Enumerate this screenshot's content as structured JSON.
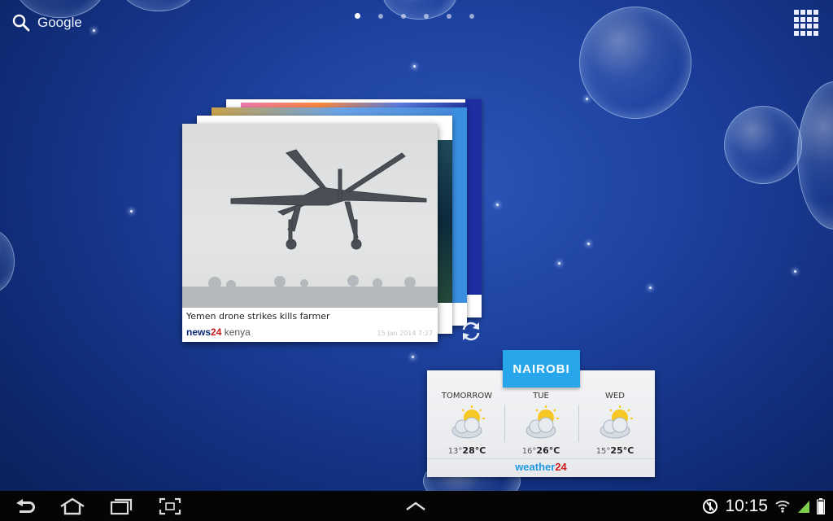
{
  "search": {
    "label": "Google"
  },
  "home": {
    "page_count": 6,
    "active_page": 1
  },
  "news": {
    "headline": "Yemen drone strikes kills farmer",
    "brand_news": "news",
    "brand_num": "24",
    "brand_region": "kenya",
    "date": "15 Jan 2014 7:27"
  },
  "weather": {
    "city": "NAIROBI",
    "days": [
      {
        "day": "TOMORROW",
        "low": "13°",
        "high": "28°C"
      },
      {
        "day": "TUE",
        "low": "16°",
        "high": "26°C"
      },
      {
        "day": "WED",
        "low": "15°",
        "high": "25°C"
      }
    ],
    "brand_word": "weather",
    "brand_num": "24"
  },
  "status": {
    "time": "10:15"
  }
}
